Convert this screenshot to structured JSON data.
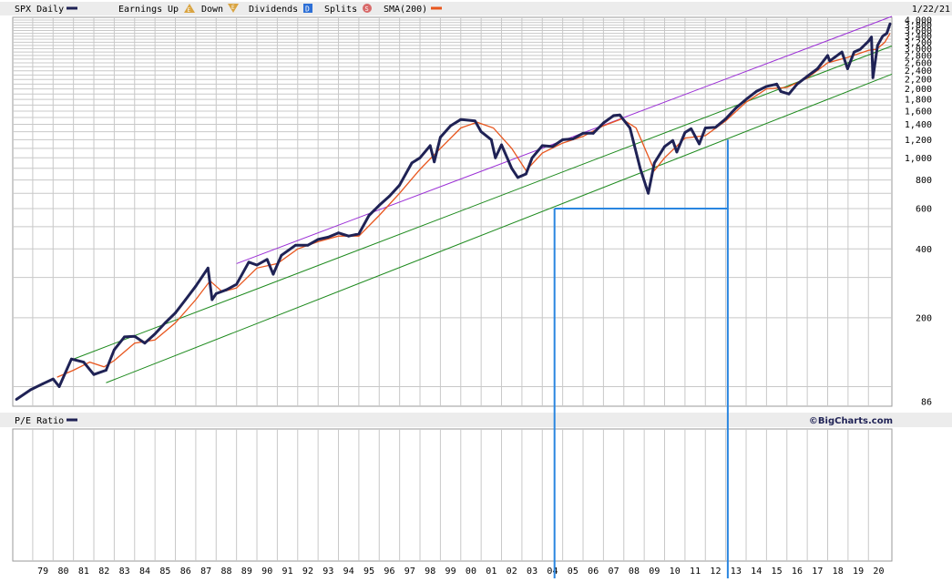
{
  "header": {
    "symbol_label": "SPX Daily",
    "earnings_label": "Earnings",
    "up_label": "Up",
    "down_label": "Down",
    "dividends_label": "Dividends",
    "splits_label": "Splits",
    "sma_label": "SMA(200)",
    "date_label": "1/22/21",
    "up_icon_glyph": "E",
    "down_icon_glyph": "E",
    "dividend_icon_glyph": "D",
    "split_icon_glyph": "S"
  },
  "lower_panel": {
    "label": "P/E Ratio",
    "copyright": "©BigCharts.com"
  },
  "colors": {
    "price": "#1f2255",
    "sma": "#e8561e",
    "upper_channel": "#9b2fd6",
    "green_channel": "#1d8a1d",
    "marker": "#2a86e0",
    "grid": "#c8c8c8",
    "header_bg": "#ececec"
  },
  "chart_data": {
    "type": "line",
    "scale": "log",
    "ylim": [
      86,
      4000
    ],
    "y_ticks": [
      "86",
      "200",
      "400",
      "600",
      "800",
      "1,000",
      "1,200",
      "1,400",
      "1,600",
      "1,800",
      "2,000",
      "2,200",
      "2,400",
      "2,600",
      "2,800",
      "3,000",
      "3,200",
      "3,400",
      "3,600",
      "3,800",
      "4,000"
    ],
    "y_tick_values": [
      86,
      200,
      400,
      600,
      800,
      1000,
      1200,
      1400,
      1600,
      1800,
      2000,
      2200,
      2400,
      2600,
      2800,
      3000,
      3200,
      3400,
      3600,
      3800,
      4000
    ],
    "x_ticks": [
      "79",
      "80",
      "81",
      "82",
      "83",
      "84",
      "85",
      "86",
      "87",
      "88",
      "89",
      "90",
      "91",
      "92",
      "93",
      "94",
      "95",
      "96",
      "97",
      "98",
      "99",
      "00",
      "01",
      "02",
      "03",
      "04",
      "05",
      "06",
      "07",
      "08",
      "09",
      "10",
      "11",
      "12",
      "13",
      "14",
      "15",
      "16",
      "17",
      "18",
      "19",
      "20"
    ],
    "xlim": [
      1978.2,
      2021.15
    ],
    "series": [
      {
        "name": "SPX Daily",
        "x": [
          1978.2,
          1978.9,
          1979.5,
          1980.0,
          1980.3,
          1980.9,
          1981.5,
          1982.0,
          1982.6,
          1983.0,
          1983.5,
          1984.0,
          1984.5,
          1985.0,
          1985.5,
          1986.0,
          1986.5,
          1987.0,
          1987.6,
          1987.8,
          1988.0,
          1988.5,
          1989.0,
          1989.6,
          1990.0,
          1990.5,
          1990.8,
          1991.2,
          1991.9,
          1992.5,
          1993.0,
          1993.5,
          1994.0,
          1994.5,
          1995.0,
          1995.5,
          1996.0,
          1996.5,
          1997.0,
          1997.6,
          1998.0,
          1998.5,
          1998.7,
          1999.0,
          1999.5,
          2000.0,
          2000.7,
          2001.0,
          2001.5,
          2001.7,
          2002.0,
          2002.5,
          2002.8,
          2003.2,
          2003.5,
          2004.0,
          2004.5,
          2005.0,
          2005.5,
          2006.0,
          2006.5,
          2007.0,
          2007.5,
          2007.8,
          2008.3,
          2008.8,
          2009.2,
          2009.5,
          2010.0,
          2010.4,
          2010.6,
          2011.0,
          2011.3,
          2011.7,
          2012.0,
          2012.5,
          2013.0,
          2013.5,
          2014.0,
          2014.5,
          2015.0,
          2015.5,
          2015.7,
          2016.1,
          2016.5,
          2017.0,
          2017.5,
          2018.0,
          2018.1,
          2018.7,
          2018.98,
          2019.3,
          2019.6,
          2020.0,
          2020.15,
          2020.22,
          2020.45,
          2020.7,
          2020.9,
          2021.06
        ],
        "values": [
          88,
          97,
          103,
          108,
          100,
          132,
          128,
          113,
          118,
          145,
          165,
          166,
          155,
          170,
          190,
          210,
          240,
          275,
          330,
          240,
          255,
          265,
          280,
          350,
          340,
          360,
          310,
          375,
          415,
          415,
          440,
          450,
          470,
          455,
          465,
          560,
          620,
          680,
          760,
          950,
          1000,
          1130,
          960,
          1230,
          1380,
          1470,
          1450,
          1300,
          1200,
          1000,
          1140,
          900,
          820,
          850,
          1000,
          1130,
          1120,
          1200,
          1210,
          1280,
          1280,
          1420,
          1530,
          1540,
          1350,
          900,
          700,
          950,
          1120,
          1190,
          1060,
          1290,
          1340,
          1150,
          1350,
          1360,
          1480,
          1650,
          1800,
          1950,
          2050,
          2100,
          1950,
          1900,
          2100,
          2270,
          2450,
          2800,
          2650,
          2900,
          2450,
          2900,
          2980,
          3230,
          3370,
          2240,
          3100,
          3400,
          3500,
          3850
        ]
      },
      {
        "name": "SMA(200)",
        "x": [
          1980.2,
          1981.0,
          1981.8,
          1982.5,
          1983.0,
          1984.0,
          1985.0,
          1986.0,
          1987.0,
          1987.7,
          1988.3,
          1989.0,
          1990.0,
          1991.0,
          1992.0,
          1993.0,
          1994.0,
          1995.0,
          1996.0,
          1997.0,
          1998.0,
          1999.0,
          2000.0,
          2000.8,
          2001.6,
          2002.5,
          2003.2,
          2004.0,
          2005.0,
          2006.0,
          2007.0,
          2007.9,
          2008.6,
          2009.5,
          2010.0,
          2011.0,
          2012.0,
          2013.0,
          2014.0,
          2015.0,
          2016.0,
          2017.0,
          2018.0,
          2019.0,
          2020.0,
          2020.4,
          2020.8,
          2021.06
        ],
        "values": [
          110,
          118,
          128,
          122,
          130,
          155,
          160,
          190,
          240,
          290,
          260,
          270,
          330,
          345,
          400,
          430,
          455,
          455,
          560,
          700,
          890,
          1100,
          1350,
          1430,
          1350,
          1100,
          880,
          1050,
          1160,
          1240,
          1380,
          1480,
          1350,
          880,
          1000,
          1220,
          1250,
          1450,
          1750,
          2000,
          2030,
          2230,
          2600,
          2750,
          2950,
          2980,
          3200,
          3500
        ]
      }
    ],
    "trendlines": [
      {
        "name": "upper",
        "x": [
          1989.0,
          2021.15
        ],
        "values": [
          345,
          4150
        ]
      },
      {
        "name": "middle",
        "x": [
          1981.0,
          2021.15
        ],
        "values": [
          132,
          3080
        ]
      },
      {
        "name": "lower",
        "x": [
          1982.6,
          2021.15
        ],
        "values": [
          104,
          2320
        ]
      }
    ],
    "annotations": [
      {
        "name": "marker-2004",
        "x": 2004.6,
        "y": 600
      },
      {
        "name": "marker-2013",
        "x": 2013.1,
        "y": 1200
      }
    ]
  }
}
